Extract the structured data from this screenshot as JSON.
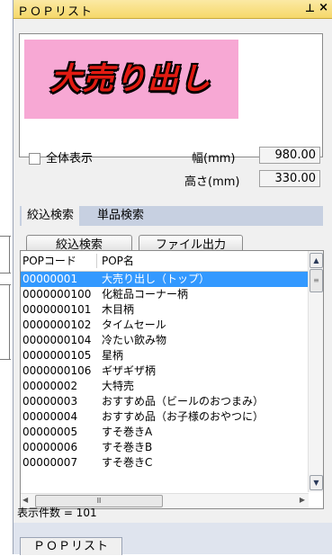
{
  "window": {
    "title": "ＰＯＰリスト",
    "pin_glyph": "⊥",
    "close_glyph": "×"
  },
  "preview": {
    "image_text": "大売り出し",
    "image_bg": "#f7a8d4",
    "text_color": "#e21b12"
  },
  "options": {
    "show_all_label": "全体表示",
    "show_all_checked": false
  },
  "size": {
    "width_label": "幅(mm)",
    "width_value": "980.00",
    "height_label": "高さ(mm)",
    "height_value": "330.00"
  },
  "tabs": [
    {
      "label": "絞込検索",
      "active": true
    },
    {
      "label": "単品検索",
      "active": false
    }
  ],
  "buttons": {
    "search": "絞込検索",
    "export": "ファイル出力"
  },
  "table": {
    "columns": [
      "POPコード",
      "POP名"
    ],
    "rows": [
      {
        "code": "00000001",
        "name": "大売り出し（トップ）",
        "selected": true
      },
      {
        "code": "0000000100",
        "name": "化粧品コーナー柄"
      },
      {
        "code": "0000000101",
        "name": "木目柄"
      },
      {
        "code": "0000000102",
        "name": "タイムセール"
      },
      {
        "code": "0000000104",
        "name": "冷たい飲み物"
      },
      {
        "code": "0000000105",
        "name": "星柄"
      },
      {
        "code": "0000000106",
        "name": "ギザギザ柄"
      },
      {
        "code": "00000002",
        "name": "大特売"
      },
      {
        "code": "00000003",
        "name": "おすすめ品（ビールのおつまみ）"
      },
      {
        "code": "00000004",
        "name": "おすすめ品（お子様のおやつに）"
      },
      {
        "code": "00000005",
        "name": "すそ巻きA"
      },
      {
        "code": "00000006",
        "name": "すそ巻きB"
      },
      {
        "code": "00000007",
        "name": "すそ巻きC"
      }
    ]
  },
  "status": {
    "count_text": "表示件数 = 101"
  },
  "bottom_tab": {
    "label": "ＰＯＰリスト"
  },
  "colors": {
    "title_bg": "#f6d86a",
    "selection": "#3399ff",
    "tab_strip": "#c7d0e1"
  }
}
